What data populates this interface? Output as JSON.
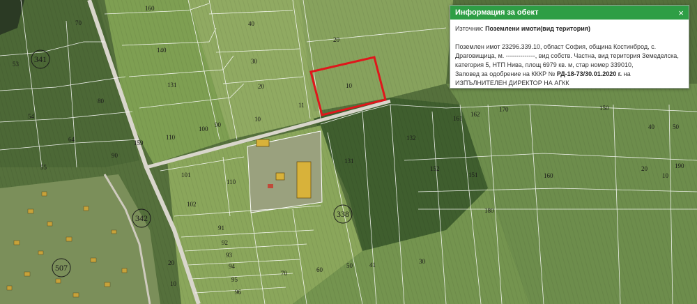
{
  "info_panel": {
    "title": "Информация за обект",
    "close_symbol": "×",
    "source_label": "Източник:",
    "source_value": "Поземлени имоти(вид територия)",
    "description": "Поземлен имот 23296.339.10, област София, община Костинброд, с. Драговищица, м. --------------, вид собств. Частна, вид територия Земеделска, категория 5, НТП Нива, площ 6979 кв. м, стар номер 339010,",
    "order_prefix": "Заповед за одобрение на КККР №",
    "order_number": "РД-18-73/30.01.2020 г.",
    "order_suffix": "на",
    "order_authority": "ИЗПЪЛНИТЕЛЕН ДИРЕКТОР НА АГКК"
  },
  "map": {
    "block_labels": [
      "341",
      "338",
      "342",
      "507"
    ],
    "parcel_labels": [
      "160",
      "70",
      "53",
      "140",
      "131",
      "80",
      "54",
      "64",
      "55",
      "90",
      "110",
      "100",
      "90",
      "159",
      "40",
      "30",
      "20",
      "10",
      "11",
      "20",
      "10",
      "101",
      "102",
      "110",
      "131",
      "132",
      "161",
      "162",
      "170",
      "150",
      "151",
      "152",
      "160",
      "180",
      "190",
      "91",
      "92",
      "93",
      "94",
      "95",
      "96",
      "70",
      "60",
      "50",
      "41",
      "30",
      "20",
      "10",
      "40",
      "50",
      "20",
      "10"
    ],
    "colors": {
      "selected_parcel": "#e0161b",
      "boundary": "#ffffff",
      "header": "#2e9e45"
    }
  }
}
